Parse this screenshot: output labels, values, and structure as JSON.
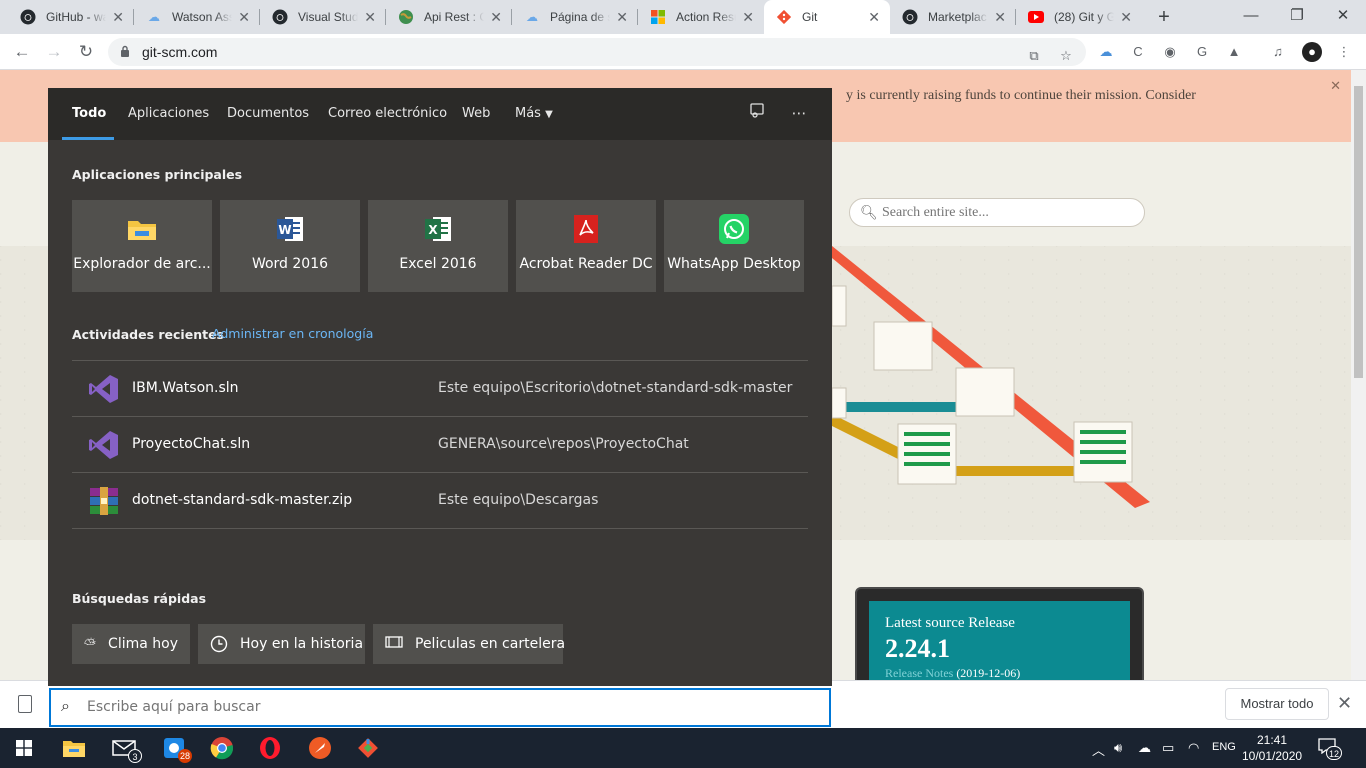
{
  "browser": {
    "tabs": [
      {
        "title": "GitHub - wa",
        "icon": "github-icon"
      },
      {
        "title": "Watson Ass",
        "icon": "cloud-icon"
      },
      {
        "title": "Visual Studi",
        "icon": "github-icon"
      },
      {
        "title": "Api Rest : C",
        "icon": "globe-icon"
      },
      {
        "title": "Página de s",
        "icon": "cloud-icon"
      },
      {
        "title": "Action Resu",
        "icon": "microsoft-icon"
      },
      {
        "title": "Git",
        "icon": "git-icon",
        "active": true
      },
      {
        "title": "Marketplac",
        "icon": "github-icon"
      },
      {
        "title": "(28) Git y G",
        "icon": "youtube-icon"
      }
    ],
    "new_tab": "+",
    "url": "git-scm.com"
  },
  "page": {
    "banner_text": "y is currently raising funds to continue their mission. Consider",
    "search_placeholder": "Search entire site...",
    "release": {
      "title": "Latest source Release",
      "version": "2.24.1",
      "notes_label": "Release Notes",
      "date": "(2019-12-06)"
    }
  },
  "download_shelf": {
    "show_all": "Mostrar todo"
  },
  "search": {
    "tabs": [
      "Todo",
      "Aplicaciones",
      "Documentos",
      "Correo electrónico",
      "Web",
      "Más"
    ],
    "top_apps_heading": "Aplicaciones principales",
    "apps": [
      {
        "label": "Explorador de arc...",
        "icon": "folder-icon"
      },
      {
        "label": "Word 2016",
        "icon": "word-icon"
      },
      {
        "label": "Excel 2016",
        "icon": "excel-icon"
      },
      {
        "label": "Acrobat Reader DC",
        "icon": "acrobat-icon"
      },
      {
        "label": "WhatsApp Desktop",
        "icon": "whatsapp-icon"
      }
    ],
    "recent_heading": "Actividades recientes",
    "timeline_link": "Administrar en cronología",
    "recent": [
      {
        "name": "IBM.Watson.sln",
        "path": "Este equipo\\Escritorio\\dotnet-standard-sdk-master",
        "icon": "visual-studio-icon"
      },
      {
        "name": "ProyectoChat.sln",
        "path": "GENERA\\source\\repos\\ProyectoChat",
        "icon": "visual-studio-icon"
      },
      {
        "name": "dotnet-standard-sdk-master.zip",
        "path": "Este equipo\\Descargas",
        "icon": "winrar-icon"
      }
    ],
    "quick_heading": "Búsquedas rápidas",
    "quick": [
      {
        "label": "Clima hoy",
        "icon": "weather-icon"
      },
      {
        "label": "Hoy en la historia",
        "icon": "clock-icon"
      },
      {
        "label": "Peliculas en cartelera",
        "icon": "film-icon"
      }
    ],
    "input_placeholder": "Escribe aquí para buscar"
  },
  "taskbar": {
    "mail_badge": "3",
    "chrome_badge": "28",
    "language": "ENG",
    "time": "21:41",
    "date": "10/01/2020",
    "notifications": "12"
  },
  "colors": {
    "flyout_bg": "#3a3836",
    "accent": "#0078d7",
    "link": "#6bb6f5",
    "banner": "#f8c7b1",
    "release_teal": "#0c8a91",
    "taskbar": "#1a2330"
  }
}
